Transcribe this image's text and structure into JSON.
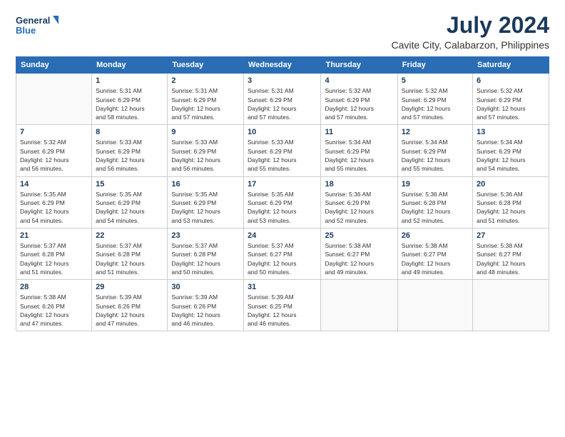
{
  "logo": {
    "line1": "General",
    "line2": "Blue"
  },
  "title": "July 2024",
  "subtitle": "Cavite City, Calabarzon, Philippines",
  "days_header": [
    "Sunday",
    "Monday",
    "Tuesday",
    "Wednesday",
    "Thursday",
    "Friday",
    "Saturday"
  ],
  "weeks": [
    [
      {
        "num": "",
        "info": ""
      },
      {
        "num": "1",
        "info": "Sunrise: 5:31 AM\nSunset: 6:29 PM\nDaylight: 12 hours\nand 58 minutes."
      },
      {
        "num": "2",
        "info": "Sunrise: 5:31 AM\nSunset: 6:29 PM\nDaylight: 12 hours\nand 57 minutes."
      },
      {
        "num": "3",
        "info": "Sunrise: 5:31 AM\nSunset: 6:29 PM\nDaylight: 12 hours\nand 57 minutes."
      },
      {
        "num": "4",
        "info": "Sunrise: 5:32 AM\nSunset: 6:29 PM\nDaylight: 12 hours\nand 57 minutes."
      },
      {
        "num": "5",
        "info": "Sunrise: 5:32 AM\nSunset: 6:29 PM\nDaylight: 12 hours\nand 57 minutes."
      },
      {
        "num": "6",
        "info": "Sunrise: 5:32 AM\nSunset: 6:29 PM\nDaylight: 12 hours\nand 57 minutes."
      }
    ],
    [
      {
        "num": "7",
        "info": "Sunrise: 5:32 AM\nSunset: 6:29 PM\nDaylight: 12 hours\nand 56 minutes."
      },
      {
        "num": "8",
        "info": "Sunrise: 5:33 AM\nSunset: 6:29 PM\nDaylight: 12 hours\nand 56 minutes."
      },
      {
        "num": "9",
        "info": "Sunrise: 5:33 AM\nSunset: 6:29 PM\nDaylight: 12 hours\nand 56 minutes."
      },
      {
        "num": "10",
        "info": "Sunrise: 5:33 AM\nSunset: 6:29 PM\nDaylight: 12 hours\nand 55 minutes."
      },
      {
        "num": "11",
        "info": "Sunrise: 5:34 AM\nSunset: 6:29 PM\nDaylight: 12 hours\nand 55 minutes."
      },
      {
        "num": "12",
        "info": "Sunrise: 5:34 AM\nSunset: 6:29 PM\nDaylight: 12 hours\nand 55 minutes."
      },
      {
        "num": "13",
        "info": "Sunrise: 5:34 AM\nSunset: 6:29 PM\nDaylight: 12 hours\nand 54 minutes."
      }
    ],
    [
      {
        "num": "14",
        "info": "Sunrise: 5:35 AM\nSunset: 6:29 PM\nDaylight: 12 hours\nand 54 minutes."
      },
      {
        "num": "15",
        "info": "Sunrise: 5:35 AM\nSunset: 6:29 PM\nDaylight: 12 hours\nand 54 minutes."
      },
      {
        "num": "16",
        "info": "Sunrise: 5:35 AM\nSunset: 6:29 PM\nDaylight: 12 hours\nand 53 minutes."
      },
      {
        "num": "17",
        "info": "Sunrise: 5:35 AM\nSunset: 6:29 PM\nDaylight: 12 hours\nand 53 minutes."
      },
      {
        "num": "18",
        "info": "Sunrise: 5:36 AM\nSunset: 6:29 PM\nDaylight: 12 hours\nand 52 minutes."
      },
      {
        "num": "19",
        "info": "Sunrise: 5:36 AM\nSunset: 6:28 PM\nDaylight: 12 hours\nand 52 minutes."
      },
      {
        "num": "20",
        "info": "Sunrise: 5:36 AM\nSunset: 6:28 PM\nDaylight: 12 hours\nand 51 minutes."
      }
    ],
    [
      {
        "num": "21",
        "info": "Sunrise: 5:37 AM\nSunset: 6:28 PM\nDaylight: 12 hours\nand 51 minutes."
      },
      {
        "num": "22",
        "info": "Sunrise: 5:37 AM\nSunset: 6:28 PM\nDaylight: 12 hours\nand 51 minutes."
      },
      {
        "num": "23",
        "info": "Sunrise: 5:37 AM\nSunset: 6:28 PM\nDaylight: 12 hours\nand 50 minutes."
      },
      {
        "num": "24",
        "info": "Sunrise: 5:37 AM\nSunset: 6:27 PM\nDaylight: 12 hours\nand 50 minutes."
      },
      {
        "num": "25",
        "info": "Sunrise: 5:38 AM\nSunset: 6:27 PM\nDaylight: 12 hours\nand 49 minutes."
      },
      {
        "num": "26",
        "info": "Sunrise: 5:38 AM\nSunset: 6:27 PM\nDaylight: 12 hours\nand 49 minutes."
      },
      {
        "num": "27",
        "info": "Sunrise: 5:38 AM\nSunset: 6:27 PM\nDaylight: 12 hours\nand 48 minutes."
      }
    ],
    [
      {
        "num": "28",
        "info": "Sunrise: 5:38 AM\nSunset: 6:26 PM\nDaylight: 12 hours\nand 47 minutes."
      },
      {
        "num": "29",
        "info": "Sunrise: 5:39 AM\nSunset: 6:26 PM\nDaylight: 12 hours\nand 47 minutes."
      },
      {
        "num": "30",
        "info": "Sunrise: 5:39 AM\nSunset: 6:26 PM\nDaylight: 12 hours\nand 46 minutes."
      },
      {
        "num": "31",
        "info": "Sunrise: 5:39 AM\nSunset: 6:25 PM\nDaylight: 12 hours\nand 46 minutes."
      },
      {
        "num": "",
        "info": ""
      },
      {
        "num": "",
        "info": ""
      },
      {
        "num": "",
        "info": ""
      }
    ]
  ]
}
